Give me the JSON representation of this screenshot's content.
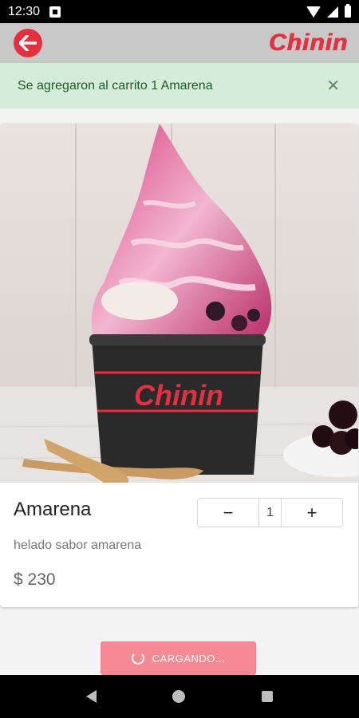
{
  "status_bar": {
    "time": "12:30"
  },
  "app_bar": {
    "brand": "Chinin",
    "accent": "#e5303f"
  },
  "alert": {
    "message": "Se agregaron al carrito 1 Amarena",
    "close_symbol": "✕",
    "background": "#d5ecd9"
  },
  "product": {
    "name": "Amarena",
    "description": "helado sabor amarena",
    "price": "$ 230",
    "cup_text": "Chinin",
    "quantity": "1",
    "minus_label": "−",
    "plus_label": "+"
  },
  "cta": {
    "label": "CARGANDO...",
    "color": "#f48a93"
  },
  "nav": {
    "icons": [
      "back-icon",
      "home-icon",
      "recents-icon"
    ]
  }
}
